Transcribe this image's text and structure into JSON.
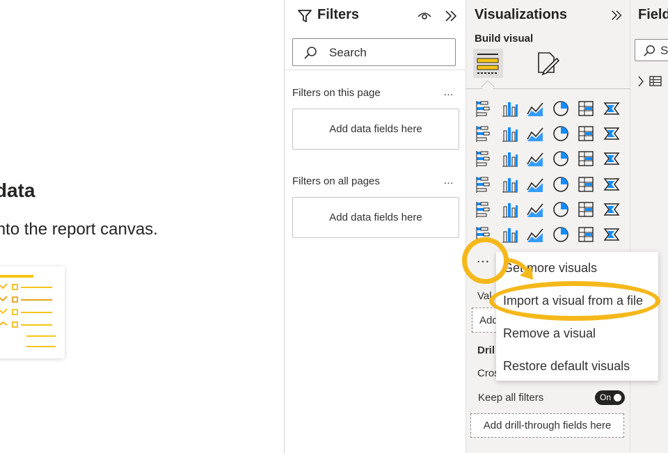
{
  "canvas": {
    "title": "our data",
    "subtitle": "ne onto the report canvas."
  },
  "filters": {
    "title": "Filters",
    "search_placeholder": "Search",
    "section_page": "Filters on this page",
    "section_all": "Filters on all pages",
    "more": "…",
    "drop_label": "Add data fields here"
  },
  "visualizations": {
    "title": "Visualizations",
    "build_visual": "Build visual",
    "more": "…",
    "values_label": "Val",
    "add_label": "Add",
    "drill_label": "Dril",
    "cross_label": "Cros",
    "keep_all_filters": "Keep all filters",
    "toggle_label": "On",
    "drill_box": "Add drill-through fields here",
    "icons": [
      "stacked-bar-chart-icon",
      "stacked-column-chart-icon",
      "clustered-bar-chart-icon",
      "clustered-column-chart-icon",
      "100-stacked-bar-chart-icon",
      "100-stacked-column-chart-icon",
      "line-chart-icon",
      "area-chart-icon",
      "stacked-area-chart-icon",
      "line-stacked-column-icon",
      "line-clustered-column-icon",
      "ribbon-chart-icon",
      "waterfall-chart-icon",
      "funnel-chart-icon",
      "scatter-chart-icon",
      "pie-chart-icon",
      "donut-chart-icon",
      "treemap-icon",
      "map-icon",
      "filled-map-icon",
      "gauge-icon",
      "card-icon",
      "multi-row-card-icon",
      "kpi-icon",
      "slicer-icon",
      "table-icon",
      "matrix-icon",
      "decomposition-tree-icon",
      "key-influencers-icon",
      "qa-icon",
      "paginated-report-icon",
      "trophy-goals-icon",
      "smart-narrative-icon",
      "power-apps-icon",
      "power-automate-icon",
      "chevron-visual-icon"
    ]
  },
  "fields": {
    "title": "Field",
    "search_placeholder": "S"
  },
  "context_menu": {
    "items": [
      "Get more visuals",
      "Import a visual from a file",
      "Remove a visual",
      "Restore default visuals"
    ]
  },
  "colors": {
    "accent": "#f5b81b",
    "icon_blue": "#118dff",
    "icon_dark": "#252423"
  }
}
